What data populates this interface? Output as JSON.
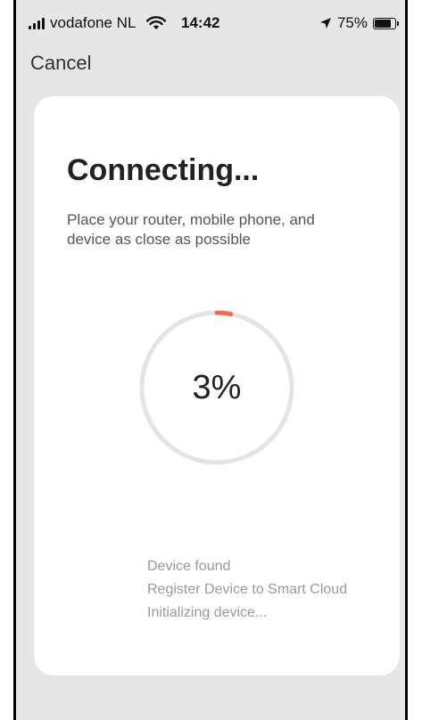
{
  "status_bar": {
    "carrier": "vodafone NL",
    "time": "14:42",
    "battery_percent": "75%",
    "battery_level": 0.75,
    "icons": [
      "signal-icon",
      "wifi-icon",
      "location-arrow-icon",
      "battery-icon"
    ]
  },
  "nav": {
    "cancel_label": "Cancel"
  },
  "card": {
    "title": "Connecting...",
    "subtitle": "Place your router, mobile phone, and device as close as possible",
    "progress_text": "3%",
    "progress_value": 0.03,
    "steps": [
      "Device found",
      "Register Device to Smart Cloud",
      "Initializing device..."
    ]
  },
  "colors": {
    "accent": "#f26b4e",
    "track": "#e4e4e4",
    "background": "#e6e6e6",
    "card": "#ffffff"
  }
}
